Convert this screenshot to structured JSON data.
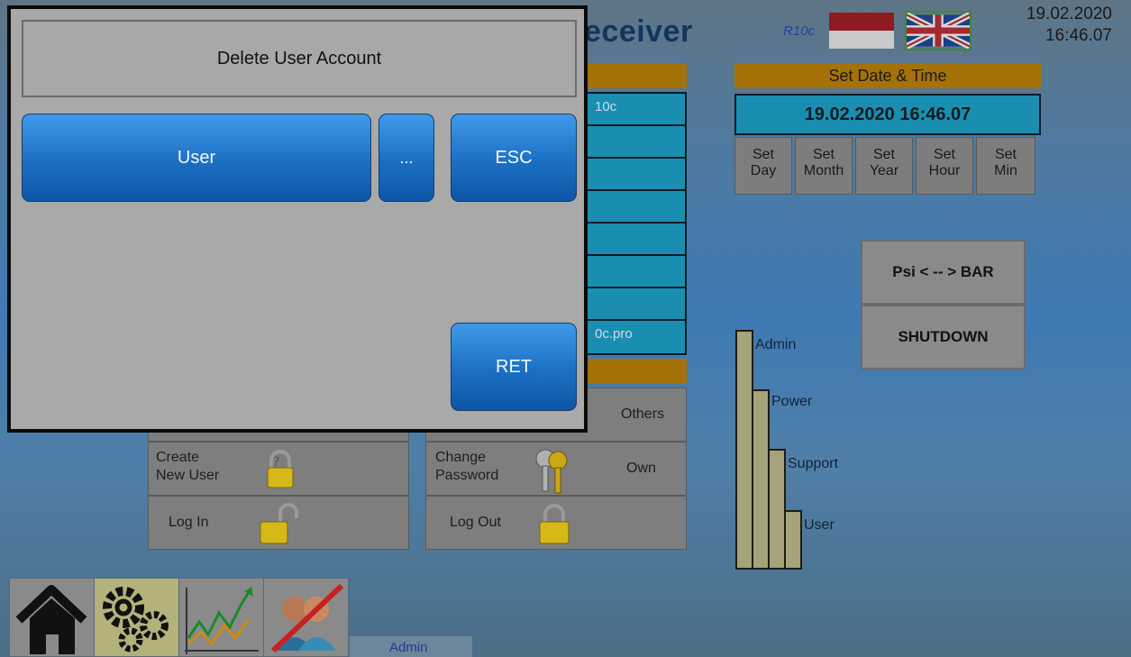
{
  "header": {
    "title_fragment": "eceiver",
    "model": "R10c",
    "date": "19.02.2020",
    "time": "16:46.07"
  },
  "left_panel": {
    "rows": [
      "10c",
      "",
      "",
      "",
      "",
      "",
      "",
      "0c.pro"
    ]
  },
  "datetime_panel": {
    "header": "Set Date & Time",
    "value": "19.02.2020 16:46.07",
    "buttons": [
      {
        "line1": "Set",
        "line2": "Day"
      },
      {
        "line1": "Set",
        "line2": "Month"
      },
      {
        "line1": "Set",
        "line2": "Year"
      },
      {
        "line1": "Set",
        "line2": "Hour"
      },
      {
        "line1": "Set",
        "line2": "Min"
      }
    ]
  },
  "actions": {
    "psi_bar": "Psi < -- > BAR",
    "shutdown": "SHUTDOWN"
  },
  "user_levels": {
    "levels": [
      "Admin",
      "Power",
      "Support",
      "User"
    ]
  },
  "user_buttons": {
    "others": "Others",
    "create_line1": "Create",
    "create_line2": "New User",
    "change_line1": "Change",
    "change_line2": "Password",
    "own": "Own",
    "log_in": "Log In",
    "log_out": "Log Out"
  },
  "toolbar": {
    "items": [
      {
        "icon": "home-icon"
      },
      {
        "icon": "gears-icon"
      },
      {
        "icon": "trend-chart-icon"
      },
      {
        "icon": "users-disabled-icon"
      }
    ],
    "current_user": "Admin"
  },
  "dialog": {
    "title": "Delete User Account",
    "user_button": "User",
    "ellipsis_button": "...",
    "esc_button": "ESC",
    "ret_button": "RET"
  },
  "colors": {
    "blue_button": "#1c6fc4",
    "cyan_field": "#1a8eb0",
    "orange_bar": "#a47208"
  }
}
